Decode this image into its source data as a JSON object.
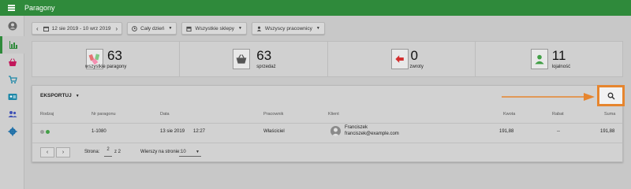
{
  "app": {
    "title": "Paragony"
  },
  "sidebar": {
    "items": [
      {
        "icon": "account-icon",
        "active": false
      },
      {
        "icon": "bar-chart-icon",
        "active": true
      },
      {
        "icon": "basket-icon",
        "active": false
      },
      {
        "icon": "cart-icon",
        "active": false
      },
      {
        "icon": "id-card-icon",
        "active": false
      },
      {
        "icon": "people-icon",
        "active": false
      },
      {
        "icon": "gear-icon",
        "active": false
      }
    ]
  },
  "filters": {
    "prev": "‹",
    "next": "›",
    "date_range": "12 sie 2019 - 10 wrz 2019",
    "time": "Cały dzień",
    "stores": "Wszystkie sklepy",
    "employees": "Wszyscy pracownicy"
  },
  "stats": [
    {
      "value": "63",
      "label": "wszystkie paragony",
      "icon": "receipts-icon"
    },
    {
      "value": "63",
      "label": "sprzedaż",
      "icon": "basket-icon"
    },
    {
      "value": "0",
      "label": "zwroty",
      "icon": "return-icon"
    },
    {
      "value": "11",
      "label": "lojalność",
      "icon": "loyalty-icon"
    }
  ],
  "table": {
    "export_label": "EKSPORTUJ",
    "headers": {
      "type": "Rodzaj",
      "number": "Nr paragonu",
      "date": "Data",
      "employee": "Pracownik",
      "client": "Klient",
      "amount": "Kwota",
      "discount": "Rabat",
      "total": "Suma"
    },
    "rows": [
      {
        "number": "1-1080",
        "date": "13 sie 2019",
        "time": "12:27",
        "employee": "Właściciel",
        "client_name": "Franciszek",
        "client_email": "franciszek@example.com",
        "amount": "191,88",
        "discount": "--",
        "total": "191,88"
      }
    ],
    "pager": {
      "page_label": "Strona:",
      "page": "2",
      "of": "z 2",
      "rows_label": "Wierszy na stronie:",
      "rows_per_page": "10"
    }
  },
  "colors": {
    "brand": "#2f8a3b",
    "highlight": "#e6852e"
  }
}
